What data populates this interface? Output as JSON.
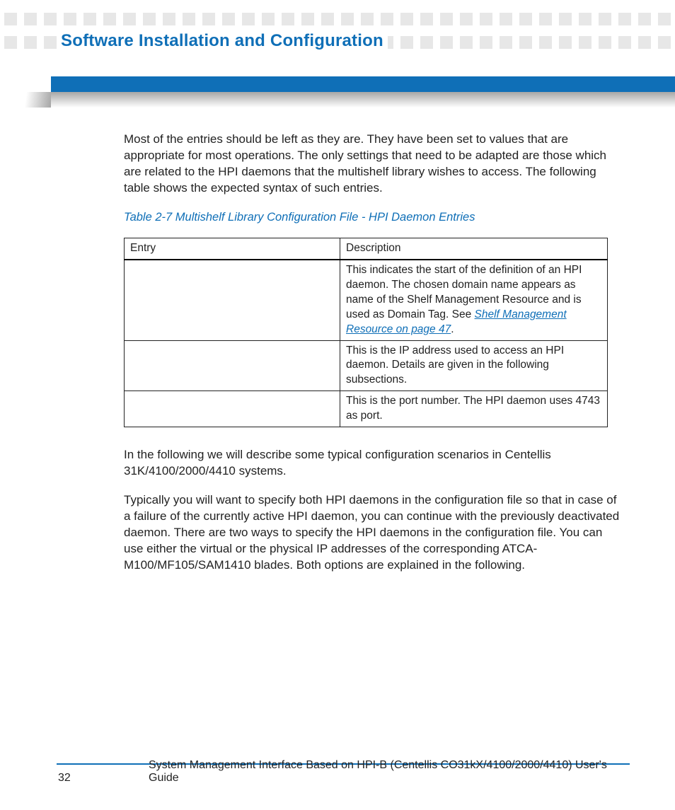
{
  "header": {
    "chapter_title": "Software Installation and Configuration"
  },
  "body": {
    "paragraph1": "Most of the entries should be left as they are. They have been set to values that are appropriate for most operations. The only settings that need to be adapted are those which are related to the HPI daemons that the multishelf library wishes to access. The following table shows the expected syntax of such entries.",
    "table_caption": "Table 2-7 Multishelf Library Configuration File - HPI Daemon Entries",
    "table": {
      "headers": {
        "col1": "Entry",
        "col2": "Description"
      },
      "rows": [
        {
          "entry": "",
          "desc_before_link": "This indicates the start of the definition of an HPI daemon. The chosen domain name appears as name of the Shelf Management Resource and is used as Domain Tag. See ",
          "link_text": "Shelf Management Resource on page 47",
          "desc_after_link": "."
        },
        {
          "entry": "",
          "desc": "This is the IP address used to access an HPI daemon. Details are given in the following subsections."
        },
        {
          "entry": "",
          "desc": "This is the port number. The HPI daemon uses 4743 as port."
        }
      ]
    },
    "paragraph2": "In the following we will describe some typical configuration scenarios in Centellis 31K/4100/2000/4410 systems.",
    "paragraph3": "Typically you will want to specify both HPI daemons in the configuration file so that in case of a failure of the currently active HPI daemon, you can continue with the previously deactivated daemon. There are two ways to specify the HPI daemons in the configuration file. You can use either the virtual or the physical IP addresses of the corresponding ATCA-M100/MF105/SAM1410 blades. Both options are explained in the following."
  },
  "footer": {
    "page_number": "32",
    "text": "System Management Interface Based on HPI-B (Centellis CO31kX/4100/2000/4410) User's Guide"
  }
}
